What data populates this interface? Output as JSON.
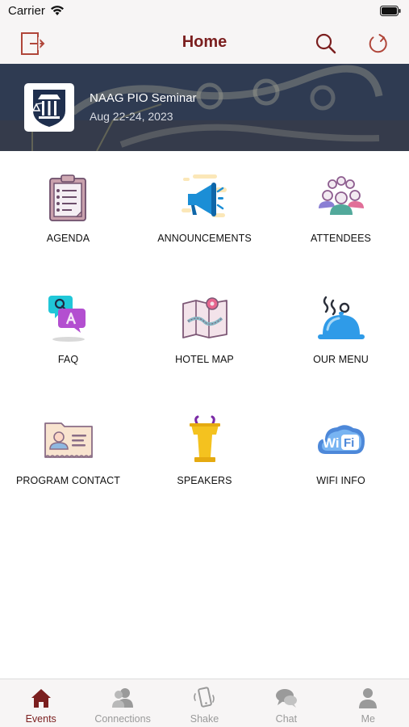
{
  "status_bar": {
    "carrier": "Carrier"
  },
  "nav": {
    "title": "Home",
    "icons": [
      "logout-icon",
      "search-icon",
      "refresh-icon"
    ]
  },
  "event": {
    "name": "NAAG PIO Seminar",
    "dates": "Aug 22-24, 2023"
  },
  "menu": {
    "items": [
      {
        "label": "AGENDA",
        "icon": "agenda-icon"
      },
      {
        "label": "ANNOUNCEMENTS",
        "icon": "megaphone-icon"
      },
      {
        "label": "ATTENDEES",
        "icon": "attendees-icon"
      },
      {
        "label": "FAQ",
        "icon": "faq-icon"
      },
      {
        "label": "HOTEL MAP",
        "icon": "map-icon"
      },
      {
        "label": "OUR MENU",
        "icon": "food-cloche-icon"
      },
      {
        "label": "PROGRAM CONTACT",
        "icon": "contact-card-icon"
      },
      {
        "label": "SPEAKERS",
        "icon": "podium-icon"
      },
      {
        "label": "WIFI INFO",
        "icon": "wifi-cloud-icon"
      }
    ]
  },
  "tab_bar": {
    "tabs": [
      {
        "label": "Events",
        "icon": "home-icon",
        "active": true
      },
      {
        "label": "Connections",
        "icon": "people-icon",
        "active": false
      },
      {
        "label": "Shake",
        "icon": "shake-phone-icon",
        "active": false
      },
      {
        "label": "Chat",
        "icon": "chat-icon",
        "active": false
      },
      {
        "label": "Me",
        "icon": "person-icon",
        "active": false
      }
    ]
  },
  "colors": {
    "accent": "#7b1f1f",
    "inactive": "#9a9a9a",
    "bar_background": "#f7f5f5"
  }
}
